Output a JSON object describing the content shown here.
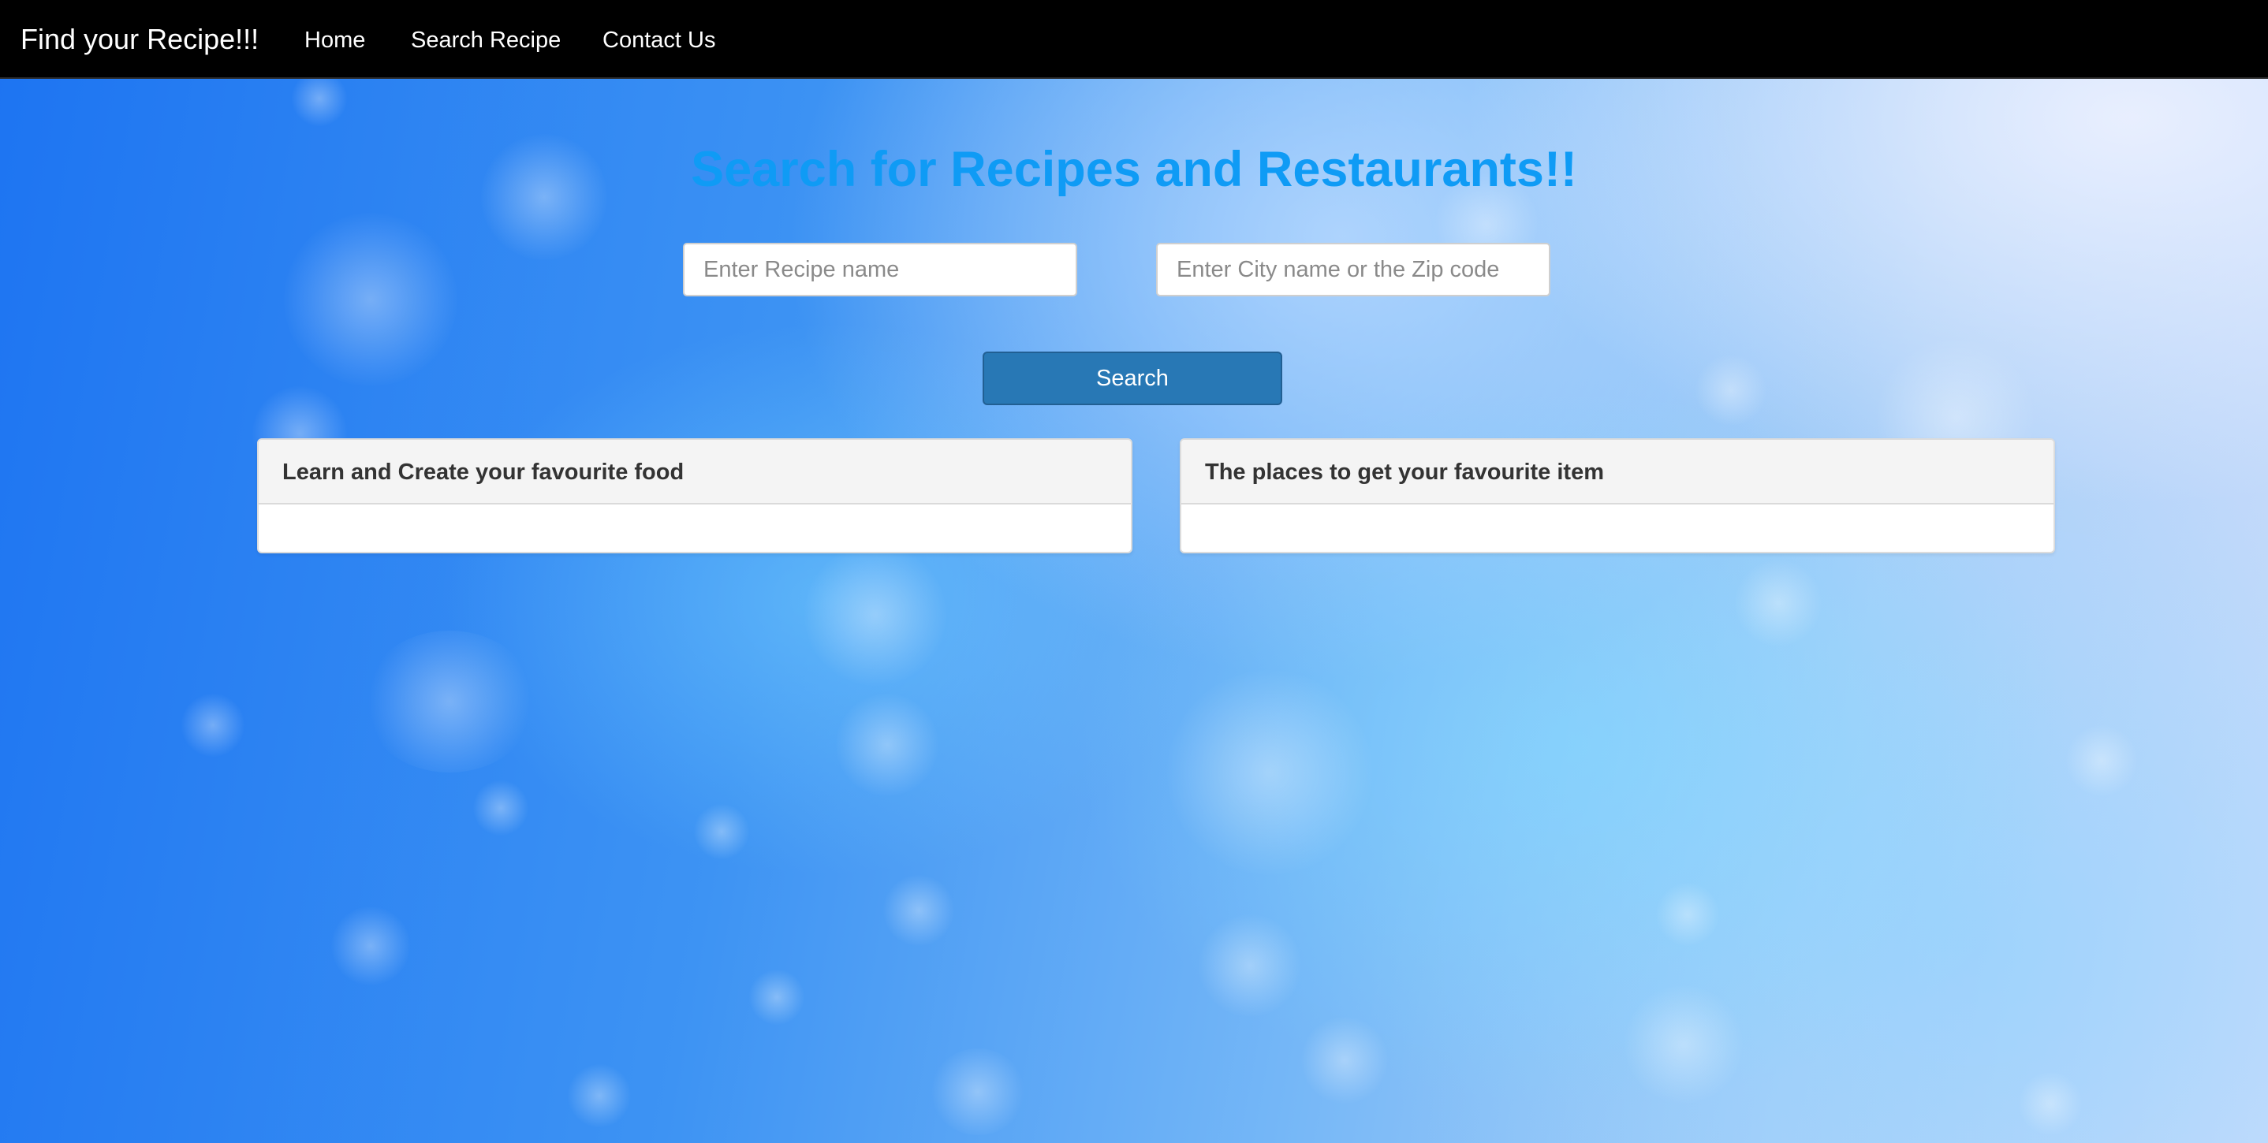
{
  "navbar": {
    "brand": "Find your Recipe!!!",
    "links": [
      {
        "label": "Home"
      },
      {
        "label": "Search Recipe"
      },
      {
        "label": "Contact Us"
      }
    ]
  },
  "main": {
    "heading": "Search for Recipes and Restaurants!!",
    "recipe_input": {
      "placeholder": "Enter Recipe name",
      "value": ""
    },
    "location_input": {
      "placeholder": "Enter City name or the Zip code",
      "value": ""
    },
    "search_label": "Search",
    "panels": [
      {
        "title": "Learn and Create your favourite food"
      },
      {
        "title": "The places to get your favourite item"
      }
    ]
  },
  "colors": {
    "navbar_bg": "#000000",
    "heading": "#0f9bf5",
    "button": "#2878b5",
    "panel_header": "#f4f4f4"
  }
}
